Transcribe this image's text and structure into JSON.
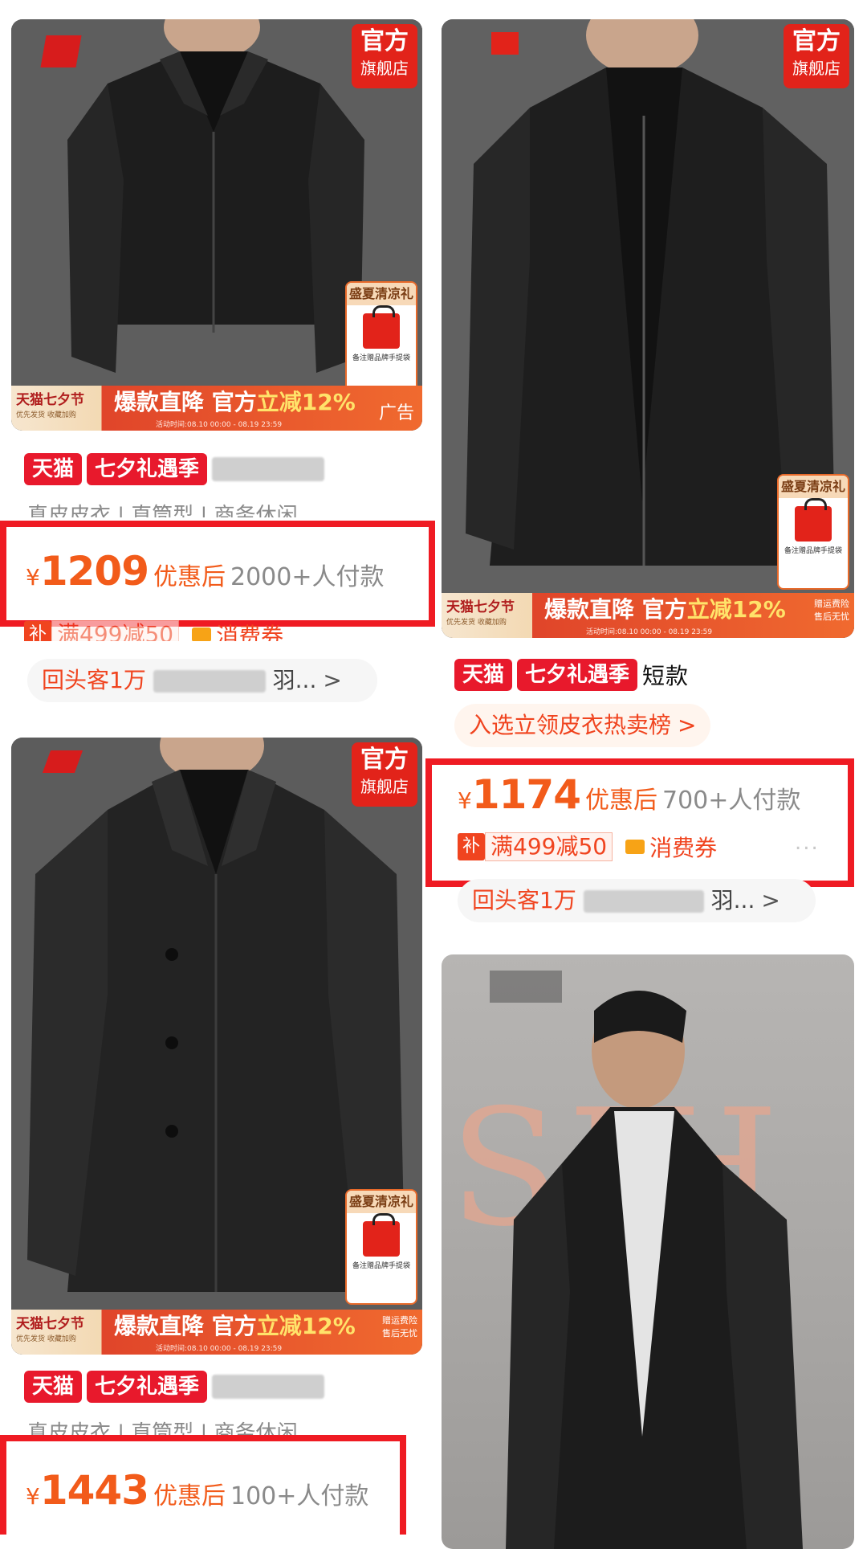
{
  "badges": {
    "official_line1": "官方",
    "official_line2": "旗舰店",
    "gift_title": "盛夏清凉礼",
    "gift_note": "备注赠品牌手提袋"
  },
  "promo": {
    "festival": "天猫七夕节",
    "festival_sub": "优先发货 收藏加购",
    "main_a": "爆款直降 官方",
    "main_b": "立减12%",
    "time": "活动时间:08.10 00:00 - 08.19 23:59",
    "right_top": "赠运费险",
    "right_bottom": "售后无忧",
    "ad": "广告"
  },
  "tags": {
    "tmall": "天猫",
    "qixi": "七夕礼遇季"
  },
  "products": [
    {
      "title_fragment": "",
      "subline": "真皮皮衣 | 直筒型 | 商务休闲",
      "currency": "¥",
      "price": "1209",
      "after_discount": "优惠后",
      "paid_count": "2000+人付款",
      "coupon_bu": "补",
      "coupon_manjian": "满499减50",
      "coupon_quan": "消费券",
      "pill": "回头客1万",
      "pill_tail": "羽...",
      "chevron": ">"
    },
    {
      "title_fragment": "短款",
      "rank_pill": "入选立领皮衣热卖榜",
      "currency": "¥",
      "price": "1174",
      "after_discount": "优惠后",
      "paid_count": "700+人付款",
      "coupon_bu": "补",
      "coupon_manjian": "满499减50",
      "coupon_quan": "消费券",
      "more": "...",
      "pill": "回头客1万",
      "pill_tail": "羽...",
      "chevron": ">"
    },
    {
      "title_fragment": "",
      "subline": "真皮皮衣 | 直筒型 | 商务休闲",
      "currency": "¥",
      "price": "1443",
      "after_discount": "优惠后",
      "paid_count": "100+人付款"
    },
    {
      "background_text": "SIH"
    }
  ],
  "colors": {
    "accent": "#ef1b23",
    "price": "#f25b1a",
    "tmall_red": "#e8192c"
  }
}
